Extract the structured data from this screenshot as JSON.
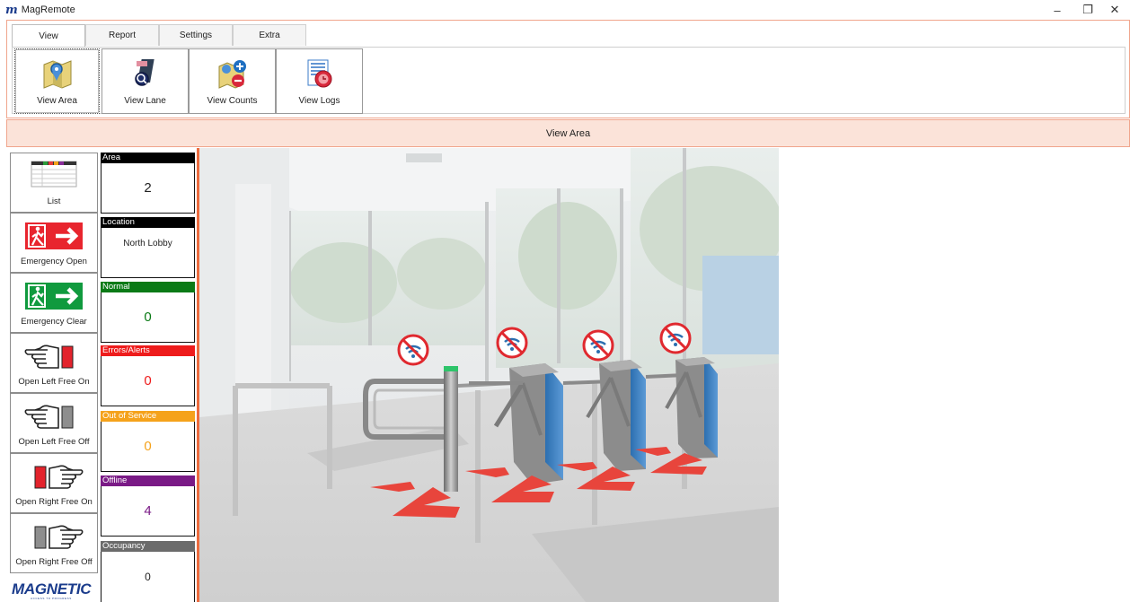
{
  "window": {
    "logo_letter": "m",
    "title": "MagRemote",
    "minimize_glyph": "–",
    "maximize_glyph": "❐",
    "close_glyph": "✕"
  },
  "ribbon": {
    "tabs": [
      {
        "label": "View",
        "active": true
      },
      {
        "label": "Report",
        "active": false
      },
      {
        "label": "Settings",
        "active": false
      },
      {
        "label": "Extra",
        "active": false
      }
    ],
    "buttons": [
      {
        "label": "View Area",
        "icon": "map-pin-icon",
        "selected": true
      },
      {
        "label": "View Lane",
        "icon": "lane-search-icon",
        "selected": false
      },
      {
        "label": "View Counts",
        "icon": "counts-plus-minus-icon",
        "selected": false
      },
      {
        "label": "View Logs",
        "icon": "logs-clock-icon",
        "selected": false
      }
    ]
  },
  "view_header": "View Area",
  "actions": [
    {
      "label": "List",
      "icon": "list-table-icon"
    },
    {
      "label": "Emergency Open",
      "icon": "emergency-exit-red-icon"
    },
    {
      "label": "Emergency Clear",
      "icon": "emergency-exit-green-icon"
    },
    {
      "label": "Open Left Free On",
      "icon": "hand-left-red-icon"
    },
    {
      "label": "Open Left Free Off",
      "icon": "hand-left-gray-icon"
    },
    {
      "label": "Open Right Free On",
      "icon": "hand-right-red-icon"
    },
    {
      "label": "Open Right Free Off",
      "icon": "hand-right-gray-icon"
    }
  ],
  "brand": {
    "name": "MAGNETIC",
    "tagline": "ACCESS TO PROGRESS"
  },
  "status": [
    {
      "header": "Area",
      "value": "2",
      "header_color": "#000000",
      "value_color": "#222222"
    },
    {
      "header": "Location",
      "value": "North Lobby",
      "header_color": "#000000",
      "value_color": "#222222"
    },
    {
      "header": "Normal",
      "value": "0",
      "header_color": "#0b7a16",
      "value_color": "#0b7a16"
    },
    {
      "header": "Errors/Alerts",
      "value": "0",
      "header_color": "#ee1c1c",
      "value_color": "#ee1c1c"
    },
    {
      "header": "Out of Service",
      "value": "0",
      "header_color": "#f5a21b",
      "value_color": "#f5a21b"
    },
    {
      "header": "Offline",
      "value": "4",
      "header_color": "#7a1a86",
      "value_color": "#7a1a86"
    },
    {
      "header": "Occupancy",
      "value": "0",
      "header_color": "#6b6b6b",
      "value_color": "#222222"
    }
  ],
  "scene": {
    "lanes_offline_count": 4,
    "accent_color": "#ec6b3e"
  }
}
